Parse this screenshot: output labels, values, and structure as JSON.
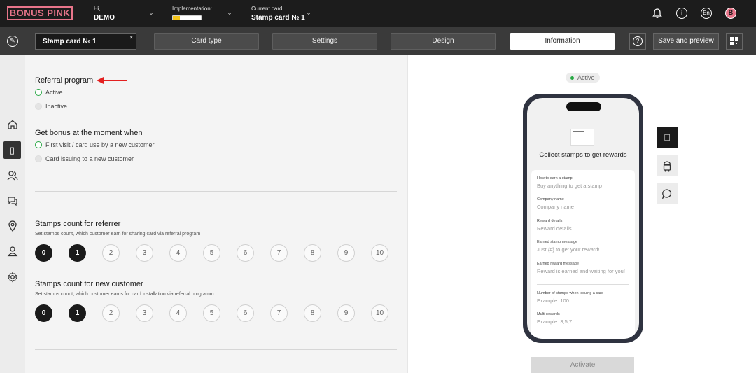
{
  "header": {
    "logo": "BONUS PINK",
    "greeting": "Hi,",
    "user": "DEMO",
    "implementation_label": "Implementation:",
    "implementation_progress": 0.25,
    "current_card_label": "Current card:",
    "current_card": "Stamp card № 1",
    "language": "En",
    "avatar_letter": "B"
  },
  "toolbar": {
    "card_name": "Stamp card № 1",
    "steps": [
      "Card type",
      "Settings",
      "Design",
      "Information"
    ],
    "active_step": "Information",
    "save_label": "Save and preview"
  },
  "form": {
    "referral": {
      "title": "Referral program",
      "options": [
        "Active",
        "Inactive"
      ],
      "selected": "Active"
    },
    "bonus": {
      "title": "Get bonus at the moment when",
      "options": [
        "First visit / card use by a new customer",
        "Card issuing to a new customer"
      ],
      "selected": "First visit / card use by a new customer"
    },
    "referrer": {
      "title": "Stamps count for referrer",
      "subtitle": "Set stamps count, which customer earn for sharing card via referral program",
      "options": [
        "0",
        "1",
        "2",
        "3",
        "4",
        "5",
        "6",
        "7",
        "8",
        "9",
        "10"
      ]
    },
    "new_customer": {
      "title": "Stamps count for new customer",
      "subtitle": "Set stamps count, which customer earns for card installation via referral programm",
      "options": [
        "0",
        "1",
        "2",
        "3",
        "4",
        "5",
        "6",
        "7",
        "8",
        "9",
        "10"
      ]
    }
  },
  "preview": {
    "status": "Active",
    "headline": "Collect stamps to get rewards",
    "fields": [
      {
        "label": "How to earn a stamp",
        "value": "Buy anything to get a stamp"
      },
      {
        "label": "Company name",
        "value": "Company name"
      },
      {
        "label": "Reward details",
        "value": "Reward details"
      },
      {
        "label": "Earned stamp message",
        "value": "Just {#} to get your reward!"
      },
      {
        "label": "Earned reward message",
        "value": "Reward is earned and waiting for you!"
      },
      {
        "label": "Number of stamps when issuing a card",
        "value": "Example: 100"
      },
      {
        "label": "Multi rewards",
        "value": "Example: 3,5,7"
      }
    ],
    "activate_label": "Activate"
  },
  "icons": {
    "sidebar": [
      "home-icon",
      "card-icon",
      "users-icon",
      "chat-icon",
      "location-icon",
      "profile-icon",
      "settings-icon"
    ],
    "preview_side": [
      "apple-icon",
      "android-icon",
      "message-icon"
    ]
  },
  "colors": {
    "brand": "#e8758a",
    "active_green": "#27a844",
    "arrow_red": "#e32020",
    "progress_yellow": "#f5c518"
  }
}
